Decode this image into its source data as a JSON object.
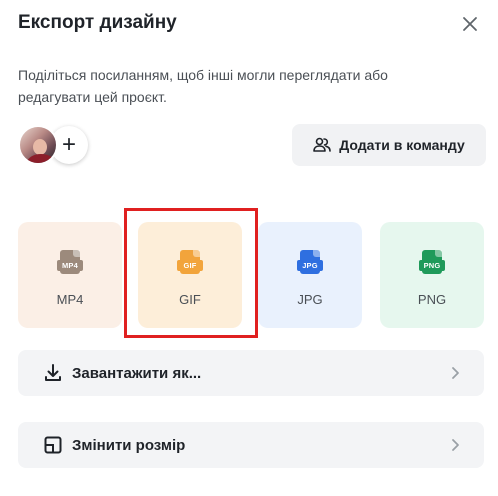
{
  "header": {
    "title": "Експорт дизайну",
    "close_icon": "close-icon"
  },
  "share": {
    "description": "Поділіться посиланням, щоб інші могли переглядати або редагувати цей проєкт.",
    "add_member_symbol": "+",
    "add_to_team_label": "Додати в команду",
    "add_to_team_icon": "people-icon"
  },
  "formats": [
    {
      "label": "MP4",
      "tag": "MP4",
      "tile_color": "#fbefe6",
      "icon_color": "#9c8a7c"
    },
    {
      "label": "GIF",
      "tag": "GIF",
      "tile_color": "#fdeed9",
      "icon_color": "#f2a43b"
    },
    {
      "label": "JPG",
      "tag": "JPG",
      "tile_color": "#e9f1fd",
      "icon_color": "#2f6fe0"
    },
    {
      "label": "PNG",
      "tag": "PNG",
      "tile_color": "#e6f7ee",
      "icon_color": "#1f9a5a"
    }
  ],
  "highlight": {
    "target": "GIF",
    "color": "#e02020"
  },
  "actions": {
    "download_label": "Завантажити як...",
    "download_icon": "download-icon",
    "resize_label": "Змінити розмір",
    "resize_icon": "resize-icon"
  }
}
